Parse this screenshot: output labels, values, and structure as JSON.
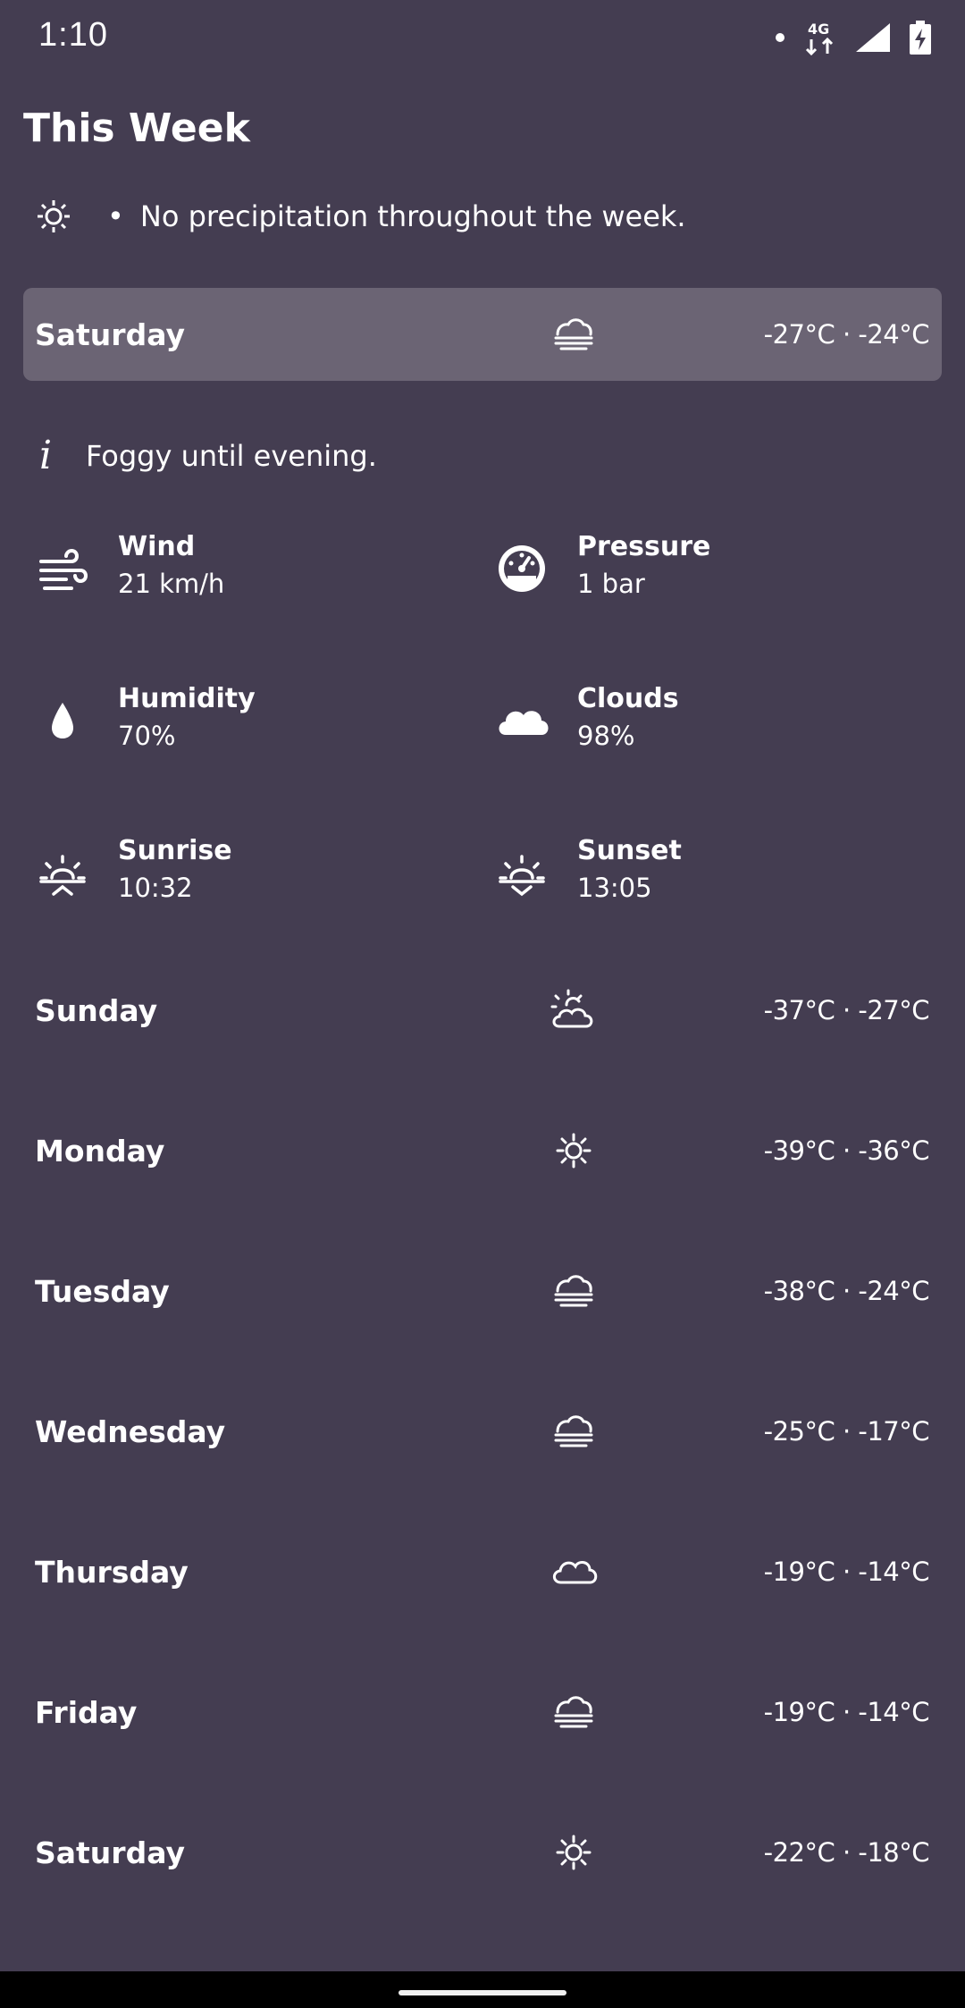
{
  "status_bar": {
    "time": "1:10",
    "network": "4G"
  },
  "header": {
    "title": "This Week"
  },
  "summary": {
    "icon": "sun-icon",
    "text": "No precipitation throughout the week."
  },
  "selected_day": {
    "name": "Saturday",
    "icon": "fog-icon",
    "temp": "-27°C · -24°C",
    "note": "Foggy until evening.",
    "details": {
      "wind": {
        "label": "Wind",
        "value": "21 km/h"
      },
      "pressure": {
        "label": "Pressure",
        "value": "1 bar"
      },
      "humidity": {
        "label": "Humidity",
        "value": "70%"
      },
      "clouds": {
        "label": "Clouds",
        "value": "98%"
      },
      "sunrise": {
        "label": "Sunrise",
        "value": "10:32"
      },
      "sunset": {
        "label": "Sunset",
        "value": "13:05"
      }
    }
  },
  "days": [
    {
      "name": "Sunday",
      "icon": "partly-cloudy-icon",
      "temp": "-37°C · -27°C"
    },
    {
      "name": "Monday",
      "icon": "sun-icon",
      "temp": "-39°C · -36°C"
    },
    {
      "name": "Tuesday",
      "icon": "fog-icon",
      "temp": "-38°C · -24°C"
    },
    {
      "name": "Wednesday",
      "icon": "fog-icon",
      "temp": "-25°C · -17°C"
    },
    {
      "name": "Thursday",
      "icon": "cloud-icon",
      "temp": "-19°C · -14°C"
    },
    {
      "name": "Friday",
      "icon": "fog-icon",
      "temp": "-19°C · -14°C"
    },
    {
      "name": "Saturday",
      "icon": "sun-icon",
      "temp": "-22°C · -18°C"
    }
  ],
  "colors": {
    "background": "#443d51",
    "selected_row": "#6b6474",
    "text": "#ffffff"
  }
}
